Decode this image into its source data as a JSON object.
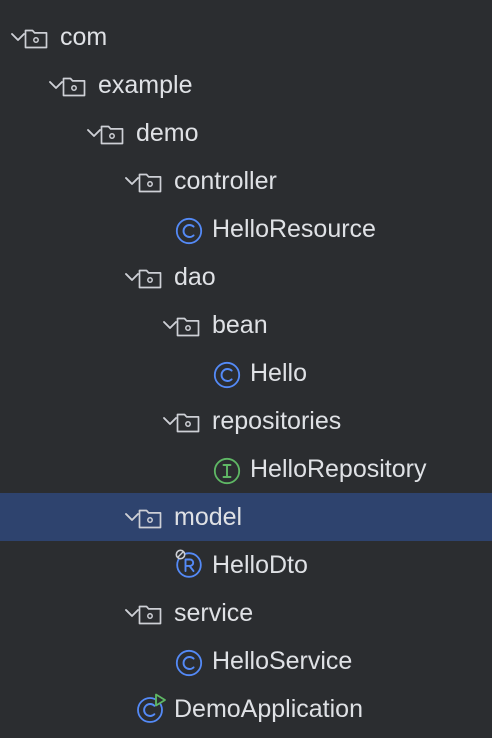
{
  "project_tree": {
    "nodes": [
      {
        "id": "com",
        "label": "com",
        "depth": 0,
        "expanded": true,
        "icon": "folder-icon",
        "selected": false
      },
      {
        "id": "example",
        "label": "example",
        "depth": 1,
        "expanded": true,
        "icon": "folder-icon",
        "selected": false
      },
      {
        "id": "demo",
        "label": "demo",
        "depth": 2,
        "expanded": true,
        "icon": "folder-icon",
        "selected": false
      },
      {
        "id": "controller",
        "label": "controller",
        "depth": 3,
        "expanded": true,
        "icon": "folder-icon",
        "selected": false
      },
      {
        "id": "helloresource",
        "label": "HelloResource",
        "depth": 4,
        "icon": "class-icon",
        "selected": false
      },
      {
        "id": "dao",
        "label": "dao",
        "depth": 3,
        "expanded": true,
        "icon": "folder-icon",
        "selected": false
      },
      {
        "id": "bean",
        "label": "bean",
        "depth": 4,
        "expanded": true,
        "icon": "folder-icon",
        "selected": false
      },
      {
        "id": "hello",
        "label": "Hello",
        "depth": 5,
        "icon": "class-icon",
        "selected": false
      },
      {
        "id": "repositories",
        "label": "repositories",
        "depth": 4,
        "expanded": true,
        "icon": "folder-icon",
        "selected": false
      },
      {
        "id": "hellorepository",
        "label": "HelloRepository",
        "depth": 5,
        "icon": "interface-icon",
        "selected": false
      },
      {
        "id": "model",
        "label": "model",
        "depth": 3,
        "expanded": true,
        "icon": "folder-icon",
        "selected": true
      },
      {
        "id": "hellodto",
        "label": "HelloDto",
        "depth": 4,
        "icon": "record-icon",
        "selected": false
      },
      {
        "id": "service",
        "label": "service",
        "depth": 3,
        "expanded": true,
        "icon": "folder-icon",
        "selected": false
      },
      {
        "id": "helloservice",
        "label": "HelloService",
        "depth": 4,
        "icon": "class-icon",
        "selected": false
      },
      {
        "id": "demoapplication",
        "label": "DemoApplication",
        "depth": 3,
        "icon": "spring-boot-class-icon",
        "selected": false
      }
    ]
  },
  "colors": {
    "background": "#2b2d30",
    "selection": "#2e436e",
    "text": "#dfe1e5",
    "class_icon": "#548af7",
    "interface_icon": "#5fb865",
    "folder_icon": "#ced0d6"
  }
}
